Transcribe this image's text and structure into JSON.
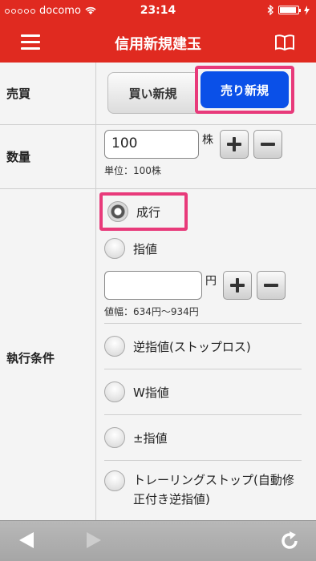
{
  "status": {
    "carrier": "docomo",
    "time": "23:14"
  },
  "nav": {
    "title": "信用新規建玉"
  },
  "buy_sell": {
    "label": "売買",
    "buy": "買い新規",
    "sell": "売り新規"
  },
  "quantity": {
    "label": "数量",
    "value": "100",
    "unit": "株",
    "hint": "単位：100株"
  },
  "conditions": {
    "label": "執行条件",
    "market": "成行",
    "limit": "指値",
    "limit_price_value": "",
    "price_unit": "円",
    "price_range": "値幅：634円〜934円",
    "stop": "逆指値(ストップロス)",
    "w_limit": "W指値",
    "pm_limit": "±指値",
    "trailing": "トレーリングストップ(自動修正付き逆指値)"
  },
  "colors": {
    "header": "#e02a20",
    "sell_active": "#0a50e8",
    "highlight": "#e83a7a"
  }
}
